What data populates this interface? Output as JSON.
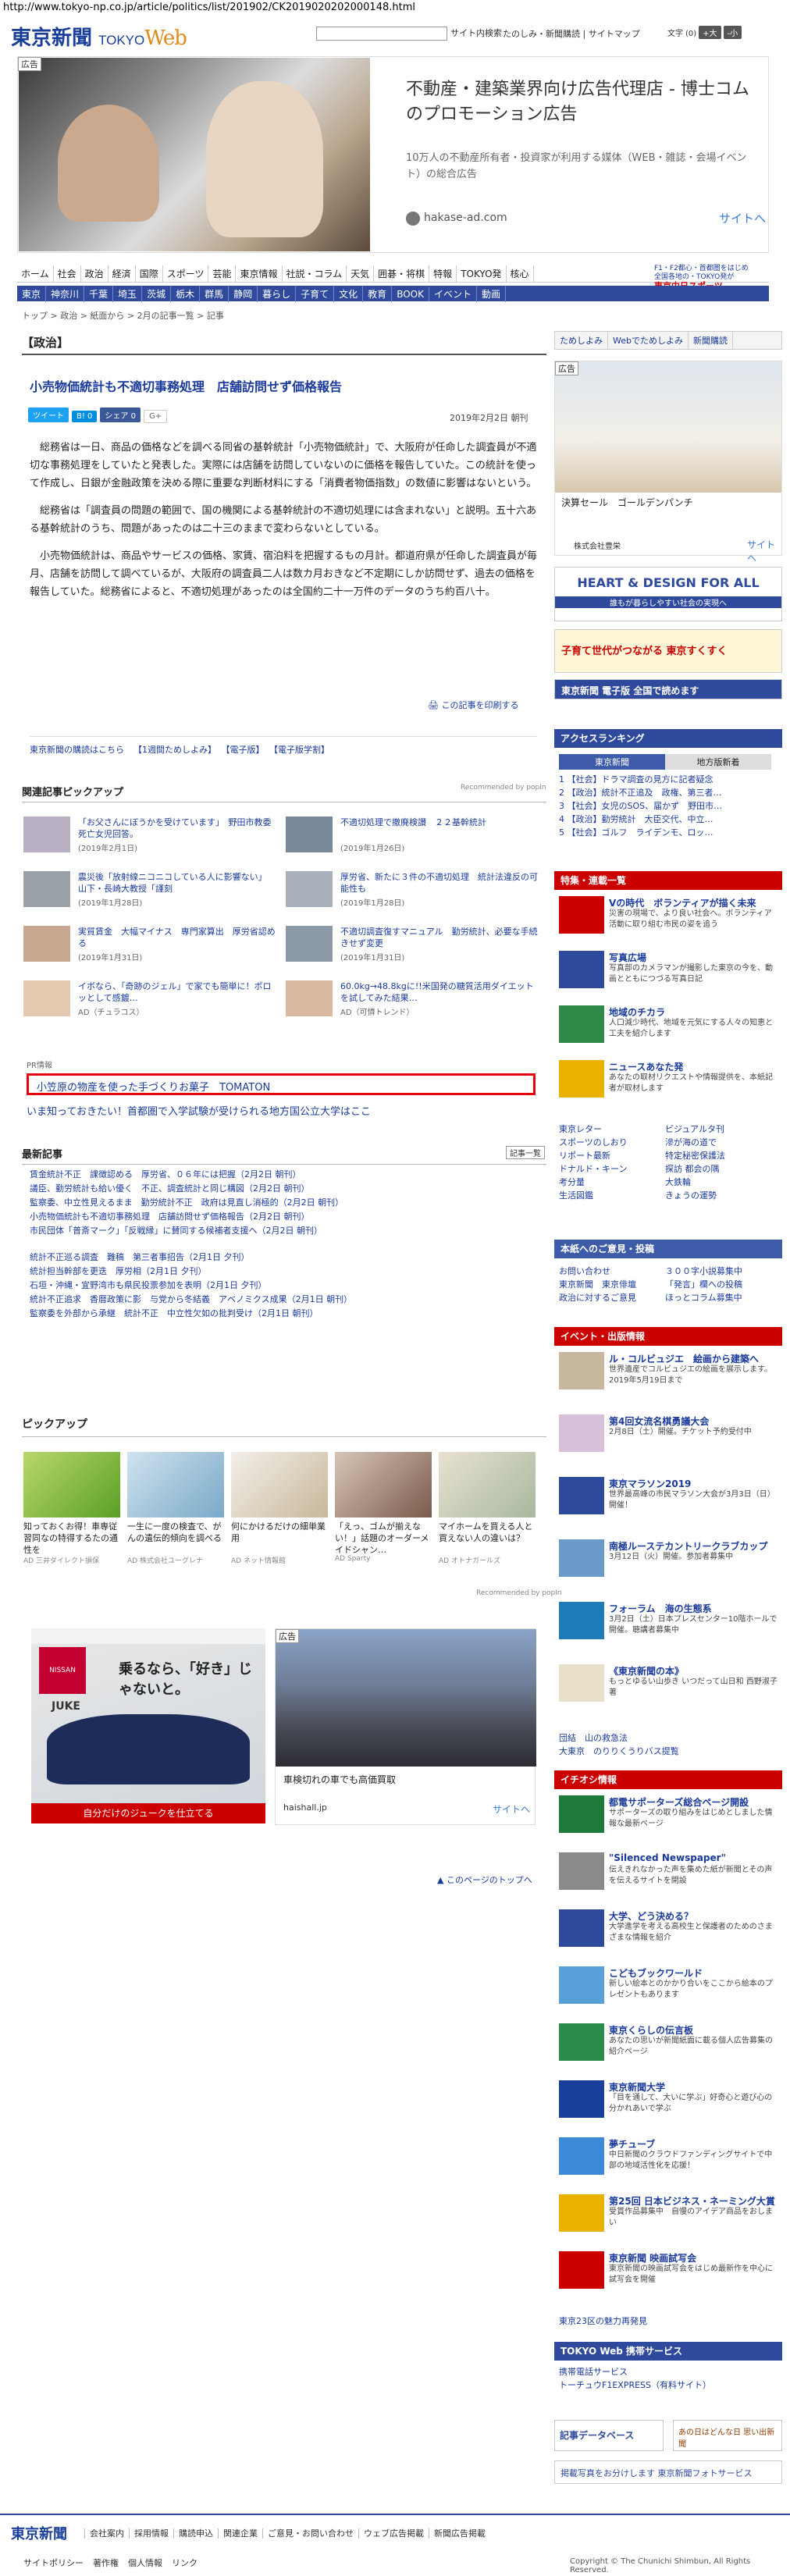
{
  "url": "http://www.tokyo-np.co.jp/article/politics/list/201902/CK2019020202000148.html",
  "header": {
    "logo": "東京新聞",
    "logo_sub_a": "TOKYO",
    "logo_sub_b": "Web",
    "search_button": "サイト内検索",
    "links": "たのしみ・新聞購読 | サイトマップ",
    "text_size": "文字",
    "text_size_value": "(0)",
    "size_up": "+大",
    "size_down": "-小"
  },
  "top_ad": {
    "tag": "広告",
    "title": "不動産・建築業界向け広告代理店 - 博士コムのプロモーション広告",
    "sub": "10万人の不動産所有者・投資家が利用する媒体（WEB・雑誌・会場イベント）の総合広告",
    "domain": "hakase-ad.com",
    "site_link": "サイトへ"
  },
  "global_nav": [
    "ホーム",
    "社会",
    "政治",
    "経済",
    "国際",
    "スポーツ",
    "芸能",
    "東京情報",
    "社説・コラム",
    "天気",
    "囲碁・将棋",
    "特報",
    "TOKYO発",
    "核心"
  ],
  "global_nav_right": [
    "F1・F2都心・首都圏をはじめ",
    "全国各地の・TOKYO発が",
    "東京中日スポーツ"
  ],
  "local_nav": [
    "東京",
    "神奈川",
    "千葉",
    "埼玉",
    "茨城",
    "栃木",
    "群馬",
    "静岡",
    "暮らし",
    "子育て",
    "文化",
    "教育",
    "BOOK",
    "イベント",
    "動画"
  ],
  "breadcrumb": "トップ > 政治 > 紙面から > 2月の記事一覧 > 記事",
  "section": "【政治】",
  "article": {
    "title": "小売物価統計も不適切事務処理　店舗訪問せず価格報告",
    "sns": [
      "ツイート",
      "B! 0",
      "シェア 0",
      "G+"
    ],
    "date": "2019年2月2日 朝刊",
    "paragraphs": [
      "総務省は一日、商品の価格などを調べる同省の基幹統計「小売物価統計」で、大阪府が任命した調査員が不適切な事務処理をしていたと発表した。実際には店舗を訪問していないのに価格を報告していた。この統計を使って作成し、日銀が金融政策を決める際に重要な判断材料にする「消費者物価指数」の数値に影響はないという。",
      "総務省は「調査員の問題の範囲で、国の機関による基幹統計の不適切処理には含まれない」と説明。五十六ある基幹統計のうち、問題があったのは二十三のままで変わらないとしている。",
      "小売物価統計は、商品やサービスの価格、家賃、宿泊料を把握するもの月計。都道府県が任命した調査員が毎月、店舗を訪問して調べているが、大阪府の調査員二人は数カ月おきなど不定期にしか訪問せず、過去の価格を報告していた。総務省によると、不適切処理があったのは全国約二十一万件のデータのうち約百八十。"
    ],
    "print_link": "この記事を印刷する",
    "links": [
      "東京新聞の購読はこちら",
      "【1週間ためしよみ】",
      "【電子版】",
      "【電子版学割】"
    ]
  },
  "related": {
    "heading": "関連記事ピックアップ",
    "recommended": "Recommended by popIn",
    "items": [
      {
        "title": "「お父さんにぼうかを受けています」　野田市教委　死亡女児回答。",
        "date": "(2019年2月1日)"
      },
      {
        "title": "不適切処理で撤廃検讃　２２基幹統計",
        "date": "(2019年1月26日)"
      },
      {
        "title": "震災後「放射線ニコニコしている人に影響ない」　山下・長崎大教授「謹刻",
        "date": "(2019年1月28日)"
      },
      {
        "title": "厚労省、新たに３件の不適切処理　統計法違反の可能性も",
        "date": "(2019年1月28日)"
      },
      {
        "title": "実質賃金　大幅マイナス　専門家算出　厚労省認める",
        "date": "(2019年1月31日)"
      },
      {
        "title": "不適切調査復すマニュアル　勤労統計、必要な手続きせず変更",
        "date": "(2019年1月31日)"
      },
      {
        "title": "イボなら、「奇跡のジェル」で家でも簡単に！ポロッとして感鍍…",
        "date": "AD（チュラコス）"
      },
      {
        "title": "60.0kg→48.8kgに!!米国発の糖質活用ダイエットを試してみた結果…",
        "date": "AD（可憐トレンド）"
      }
    ]
  },
  "pr": {
    "label": "PR情報",
    "box": "小笠原の物産を使った手づくりお菓子　TOMATON",
    "line": "いま知っておきたい！首都圏で入学試験が受けられる地方国公立大学はここ"
  },
  "latest": {
    "heading": "最新記事",
    "button": "記事一覧",
    "group1": [
      "賃金統計不正　課徴認める　厚労省、０６年には把握（2月2日 朝刊）",
      "議臣、勤労統計も給い優く　不正、調査統計と同じ構図（2月2日 朝刊）",
      "監察委、中立性見えるまま　勤労統計不正　政府は見直し消極的（2月2日 朝刊）",
      "小売物価統計も不適切事務処理　店舗訪問せず価格報告（2月2日 朝刊）",
      "市民団体「普斎マーク」「反戦縁」に賛同する候補者支援へ（2月2日 朝刊）"
    ],
    "group2": [
      "統計不正巡る調査　難稿　第三者事招告（2月1日 夕刊）",
      "統計担当幹部を更迭　厚労相（2月1日 夕刊）",
      "石垣・沖縄・宜野湾市も県民投票参加を表明（2月1日 夕刊）",
      "統計不正追求　香暦政策に影　与党から冬結義　アベノミクス成果（2月1日 朝刊）",
      "監察委を外部から承継　統計不正　中立性欠如の批判受け（2月1日 朝刊）"
    ]
  },
  "pickup": {
    "heading": "ピックアップ",
    "items": [
      {
        "title": "知っておくお得！車専従習同なの特得するたの通性を",
        "ad": "AD 三井ダイレクト損保"
      },
      {
        "title": "一生に一度の検査で、がんの遺伝的傾向を調べる",
        "ad": "AD 株式会社ユーグレナ"
      },
      {
        "title": "何にかけるだけの細単業用",
        "ad": "AD ネット情報館"
      },
      {
        "title": "「えっ、ゴムが揃えない！」話題のオーダーメイドシャン…",
        "ad": "AD Sparty"
      },
      {
        "title": "マイホームを買える人と買えない人の違いは？",
        "ad": "AD オトナガールズ"
      }
    ],
    "recommended": "Recommended by popIn"
  },
  "ad_left": {
    "brand": "NISSAN",
    "copy": "乗るなら、「好き」じゃないと。",
    "model": "JUKE",
    "bar": "自分だけのジュークを仕立てる"
  },
  "ad_right": {
    "tag": "広告",
    "title": "車検切れの車でも高価買取",
    "domain": "haishall.jp",
    "site_link": "サイトへ"
  },
  "to_top": "このページのトップへ",
  "side": {
    "buttons": [
      "ためしよみ",
      "Webでためしよみ",
      "新聞購読"
    ],
    "ad": {
      "tag": "広告",
      "title": "決算セール　ゴールデンパンチ",
      "brand": "株式会社豊栄",
      "site": "サイトへ"
    },
    "banner1": "HEART & DESIGN FOR ALL",
    "banner1_sub": "誰もが暮らしやすい社会の実現へ",
    "banner2": "子育て世代がつながる 東京すくすく",
    "banner3": "東京新聞 電子版 全国で読めます",
    "access_heading": "アクセスランキング",
    "rank_tabs": [
      "東京新聞",
      "地方版新着"
    ],
    "ranking": [
      "【社会】ドラマ調査の見方に記者疑念",
      "【政治】統計不正追及　政権、第三者…",
      "【社会】女児のSOS、届かず　野田市…",
      "【政治】勤労統計　大臣交代、中立…",
      "【社会】ゴルフ　ライデンモ、ロッ…"
    ],
    "news_heading": "特集・連載一覧",
    "features": [
      {
        "title": "Vの時代　ボランティアが描く未来",
        "text": "災害の現場で、より良い社会へ。ボランティア活動に取り組む市民の姿を追う"
      },
      {
        "title": "写真広場",
        "text": "写真部のカメラマンが撮影した東京の今を、動画とともにつづる写真日記"
      },
      {
        "title": "地域のチカラ",
        "text": "人口減少時代、地域を元気にする人々の知恵と工夫を紹介します"
      },
      {
        "title": "ニュースあなた発",
        "text": "あなたの取材リクエストや情報提供を、本紙記者が取材します"
      }
    ],
    "feature_links": [
      "東京レター",
      "ビジュアルタ刊",
      "スポーツのしおり",
      "滲が海の道で",
      "リポート最新",
      "特定秘密保護法",
      "ドナルド・キーン",
      "探訪 都会の隅",
      "考分量",
      "大鉄輪",
      "生活図鑑",
      "きょうの運勢"
    ],
    "submit_heading": "本紙へのご意見・投稿",
    "submit_links": [
      "お問い合わせ",
      "３００字小説募集中",
      "東京新聞　東京俳壇",
      "「発言」欄への投稿",
      "政治に対するご意見",
      "ほっとコラム募集中"
    ],
    "event_heading": "イベント・出版情報",
    "events": [
      {
        "title": "ル・コルビュジエ　絵画から建築へ",
        "text": "世界遺産でコルビュジエの絵画を展示します。2019年5月19日まで"
      },
      {
        "title": "第4回女流名棋勇議大会",
        "text": "2月8日（土）開催。チケット予約受付中"
      },
      {
        "title": "東京マラソン2019",
        "text": "世界最高峰の市民マラソン大会が3月3日（日）開催！"
      },
      {
        "title": "南極ルーステカントリークラブカップ",
        "text": "3月12日（火）開催。参加者募集中"
      },
      {
        "title": "フォーラム　海の生態系",
        "text": "3月2日（土）日本プレスセンター10階ホールで開催。聴講者募集中"
      },
      {
        "title": "《東京新聞の本》",
        "text": "もっとゆるい山歩き いつだって山日和 西野淑子 著"
      }
    ],
    "event_links": [
      "団結　山の救急法",
      "大東京　のりりくうりバス提覧"
    ],
    "pr_heading": "イチオシ情報",
    "pr_items": [
      {
        "title": "都電サポーターズ総合ページ開設",
        "text": "サポーターズの取り組みをはじめとしました情報な最新ページ"
      },
      {
        "title": "\"Silenced Newspaper\"",
        "text": "伝えきれなかった声を集めた紙が新聞とその声を伝えるサイトを開設"
      },
      {
        "title": "大学、どう決める？",
        "text": "大学進学を考える高校生と保護者のためのさまざまな情報を紹介"
      },
      {
        "title": "こどもブックワールド",
        "text": "新しい絵本とのかかり合いをここから絵本のプレゼントもあります"
      },
      {
        "title": "東京くらしの伝言板",
        "text": "あなたの思いが新聞紙面に載る個人広告募集の紹介ページ"
      },
      {
        "title": "東京新聞大学",
        "text": "「目を通して、大いに学ぶ」好奇心と遊び心の分かれあいで学ぶ"
      },
      {
        "title": "夢チューブ",
        "text": "中日新聞のクラウドファンディングサイトで中部の地域活性化を応援！"
      },
      {
        "title": "第25回 日本ビジネス・ネーミング大賞",
        "text": "受賞作品募集中　自慢のアイデア商品をおしまい"
      },
      {
        "title": "東京新聞 映画試写会",
        "text": "東京新聞の映画試写会をはじめ最新作を中心に試写会を開催"
      }
    ],
    "pr_link": "東京23区の魅力再発見",
    "mobile_heading": "TOKYO Web 携帯サービス",
    "mobile_links": [
      "携帯電話サービス",
      "トーチュウF1EXPRESS（有料サイト）"
    ],
    "db_btn": "記事データベース",
    "omoide_btn": "あの日はどんな日 思い出新聞",
    "photo_btn": "掲載写真をお分けします 東京新聞フォトサービス"
  },
  "footer": {
    "logo": "東京新聞",
    "links": [
      "会社案内",
      "採用情報",
      "購読申込",
      "関連企業",
      "ご意見・お問い合わせ",
      "ウェブ広告掲載",
      "新聞広告掲載"
    ],
    "links2": [
      "サイトポリシー",
      "著作権",
      "個人情報",
      "リンク"
    ],
    "copyright": "Copyright © The Chunichi Shimbun, All Rights Reserved."
  }
}
